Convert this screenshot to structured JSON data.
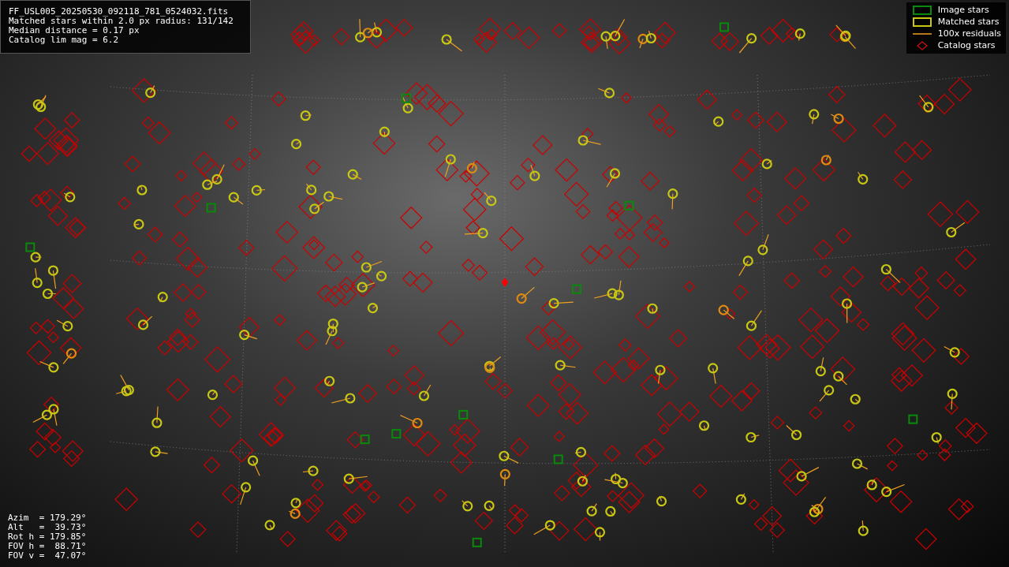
{
  "info": {
    "lines": [
      "FF_USL005_20250530_092118_781_0524032.fits",
      "Matched stars within 2.0 px radius: 131/142",
      "Median distance = 0.17 px",
      "Catalog lim mag = 6.2"
    ]
  },
  "legend": {
    "items": [
      {
        "kind": "image",
        "label": "Image stars"
      },
      {
        "kind": "matched",
        "label": "Matched stars"
      },
      {
        "kind": "residual",
        "label": "100x residuals"
      },
      {
        "kind": "catalog",
        "label": "Catalog stars"
      }
    ]
  },
  "pointing": {
    "lines": [
      "Azim  = 179.29°",
      "Alt   =  39.73°",
      "Rot h = 179.85°",
      "FOV h =  88.71°",
      "FOV v =  47.07°"
    ]
  }
}
